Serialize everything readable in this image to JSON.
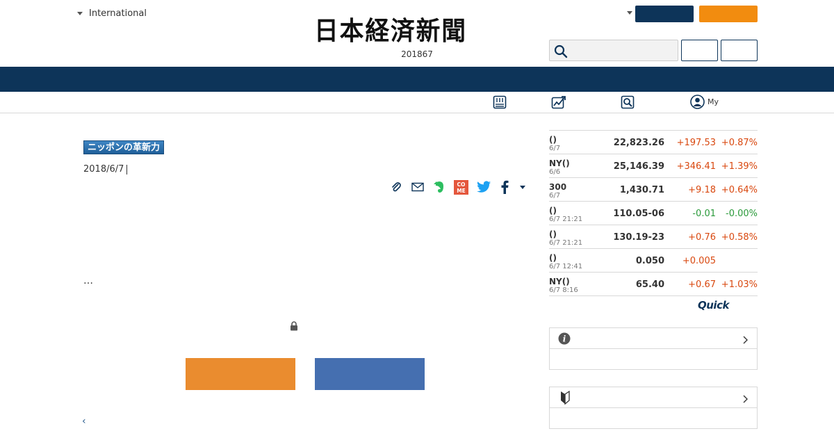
{
  "header": {
    "edition_label": "International",
    "logo_text": "日本経済新聞",
    "date_line": "201867"
  },
  "colors": {
    "navy": "#0d3459",
    "orange": "#f28c0f",
    "up": "#d9480f",
    "down": "#2b9a3b"
  },
  "subnav": {
    "my_label": "My",
    "icons": [
      "paper-icon",
      "chart-icon",
      "search-news-icon",
      "user-icon"
    ]
  },
  "article": {
    "series_badge": "ニッポンの革新力",
    "pub_date": "2018/6/7",
    "ellipsis": "…",
    "back_label": "‹",
    "share_icons": [
      "clip-icon",
      "mail-icon",
      "evernote-icon",
      "come-icon",
      "twitter-icon",
      "facebook-icon",
      "more-caret-icon"
    ],
    "come_text": "CO ME"
  },
  "markets": [
    {
      "name": "()",
      "time": "6/7",
      "value": "22,823.26",
      "change": "+197.53",
      "pct": "+0.87%",
      "dir": "up"
    },
    {
      "name": "NY()",
      "time": "6/6",
      "value": "25,146.39",
      "change": "+346.41",
      "pct": "+1.39%",
      "dir": "up"
    },
    {
      "name": "300",
      "time": "6/7",
      "value": "1,430.71",
      "change": "+9.18",
      "pct": "+0.64%",
      "dir": "up"
    },
    {
      "name": "()",
      "time": "6/7 21:21",
      "value": "110.05-06",
      "change": "-0.01",
      "pct": "-0.00%",
      "dir": "down"
    },
    {
      "name": "()",
      "time": "6/7 21:21",
      "value": "130.19-23",
      "change": "+0.76",
      "pct": "+0.58%",
      "dir": "up"
    },
    {
      "name": "()",
      "time": "6/7 12:41",
      "value": "0.050",
      "change": "+0.005",
      "pct": "",
      "dir": "up"
    },
    {
      "name": "NY()",
      "time": "6/7 8:16",
      "value": "65.40",
      "change": "+0.67",
      "pct": "+1.03%",
      "dir": "up"
    }
  ],
  "quick_logo": "Quick"
}
